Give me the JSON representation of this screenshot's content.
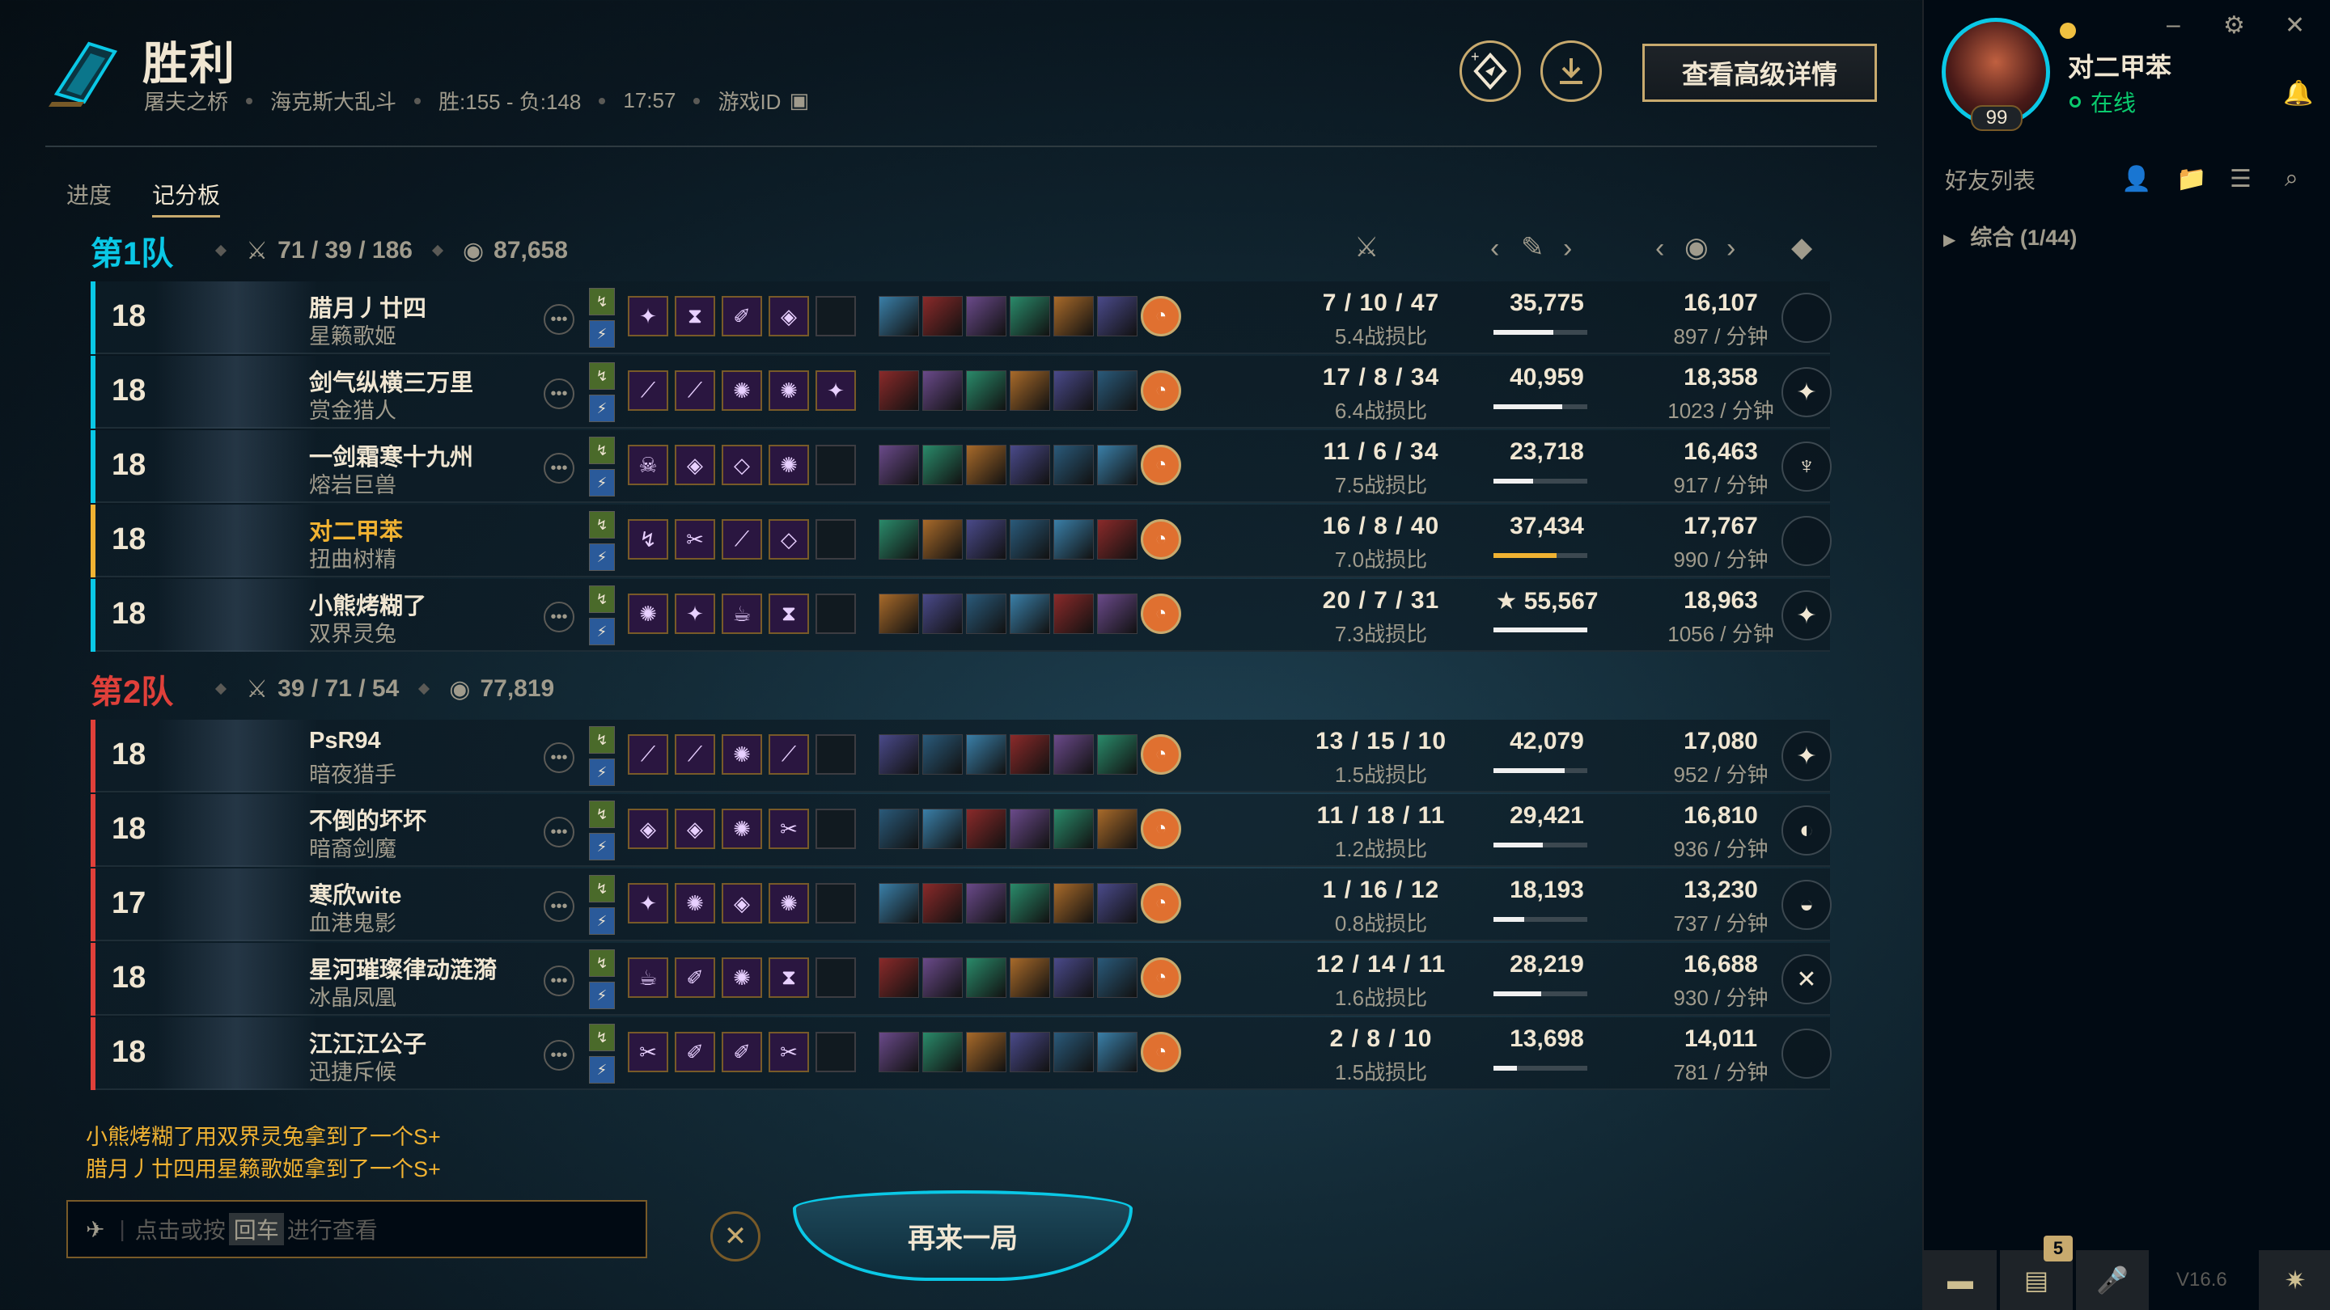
{
  "header": {
    "title": "胜利",
    "map": "屠夫之桥",
    "mode": "海克斯大乱斗",
    "record": "胜:155 - 负:148",
    "duration": "17:57",
    "game_id_label": "游戏ID",
    "advanced_button": "查看高级详情"
  },
  "tabs": [
    "进度",
    "记分板"
  ],
  "team1": {
    "name": "第1队",
    "kda": "71 / 39 / 186",
    "gold": "87,658",
    "bar_color": "#0ac8e6",
    "players": [
      {
        "level": "18",
        "name": "腊月丿廿四",
        "champ": "星籁歌姬",
        "kda": "7 / 10 / 47",
        "ratio": "5.4战损比",
        "damage": "35,775",
        "dmg_pct": 0.64,
        "gold": "16,107",
        "gpm": "897 / 分钟",
        "badge": ""
      },
      {
        "level": "18",
        "name": "剑气纵横三万里",
        "champ": "赏金猎人",
        "kda": "17 / 8 / 34",
        "ratio": "6.4战损比",
        "damage": "40,959",
        "dmg_pct": 0.73,
        "gold": "18,358",
        "gpm": "1023 / 分钟",
        "badge": "✦"
      },
      {
        "level": "18",
        "name": "一剑霜寒十九州",
        "champ": "熔岩巨兽",
        "kda": "11 / 6 / 34",
        "ratio": "7.5战损比",
        "damage": "23,718",
        "dmg_pct": 0.42,
        "gold": "16,463",
        "gpm": "917 / 分钟",
        "badge": "♆"
      },
      {
        "level": "18",
        "name": "对二甲苯",
        "champ": "扭曲树精",
        "kda": "16 / 8 / 40",
        "ratio": "7.0战损比",
        "damage": "37,434",
        "dmg_pct": 0.67,
        "gold": "17,767",
        "gpm": "990 / 分钟",
        "badge": ""
      },
      {
        "level": "18",
        "name": "小熊烤糊了",
        "champ": "双界灵兔",
        "kda": "20 / 7 / 31",
        "ratio": "7.3战损比",
        "damage": "★ 55,567",
        "dmg_pct": 1.0,
        "gold": "18,963",
        "gpm": "1056 / 分钟",
        "badge": "✦"
      }
    ]
  },
  "team2": {
    "name": "第2队",
    "kda": "39 / 71 / 54",
    "gold": "77,819",
    "bar_color": "#e0403a",
    "players": [
      {
        "level": "18",
        "name": "PsR94",
        "champ": "暗夜猎手",
        "kda": "13 / 15 / 10",
        "ratio": "1.5战损比",
        "damage": "42,079",
        "dmg_pct": 0.76,
        "gold": "17,080",
        "gpm": "952 / 分钟",
        "badge": "✦"
      },
      {
        "level": "18",
        "name": "不倒的坏坏",
        "champ": "暗裔剑魔",
        "kda": "11 / 18 / 11",
        "ratio": "1.2战损比",
        "damage": "29,421",
        "dmg_pct": 0.53,
        "gold": "16,810",
        "gpm": "936 / 分钟",
        "badge": "◐"
      },
      {
        "level": "17",
        "name": "寒欣wite",
        "champ": "血港鬼影",
        "kda": "1 / 16 / 12",
        "ratio": "0.8战损比",
        "damage": "18,193",
        "dmg_pct": 0.33,
        "gold": "13,230",
        "gpm": "737 / 分钟",
        "badge": "◒"
      },
      {
        "level": "18",
        "name": "星河璀璨律动涟漪",
        "champ": "冰晶凤凰",
        "kda": "12 / 14 / 11",
        "ratio": "1.6战损比",
        "damage": "28,219",
        "dmg_pct": 0.51,
        "gold": "16,688",
        "gpm": "930 / 分钟",
        "badge": "✕"
      },
      {
        "level": "18",
        "name": "江江江公子",
        "champ": "迅捷斥候",
        "kda": "2 / 8 / 10",
        "ratio": "1.5战损比",
        "damage": "13,698",
        "dmg_pct": 0.25,
        "gold": "14,011",
        "gpm": "781 / 分钟",
        "badge": ""
      }
    ]
  },
  "messages": [
    "小熊烤糊了用双界灵兔拿到了一个S+",
    "腊月丿廿四用星籁歌姬拿到了一个S+"
  ],
  "chat": {
    "prefix": "点击或按",
    "key": "回车",
    "suffix": "进行查看"
  },
  "play_again": "再来一局",
  "sidebar": {
    "user_name": "对二甲苯",
    "status": "在线",
    "level": "99",
    "friends_label": "好友列表",
    "group_label": "综合 (1/44)",
    "version": "V16.6",
    "notif_count": "5"
  }
}
